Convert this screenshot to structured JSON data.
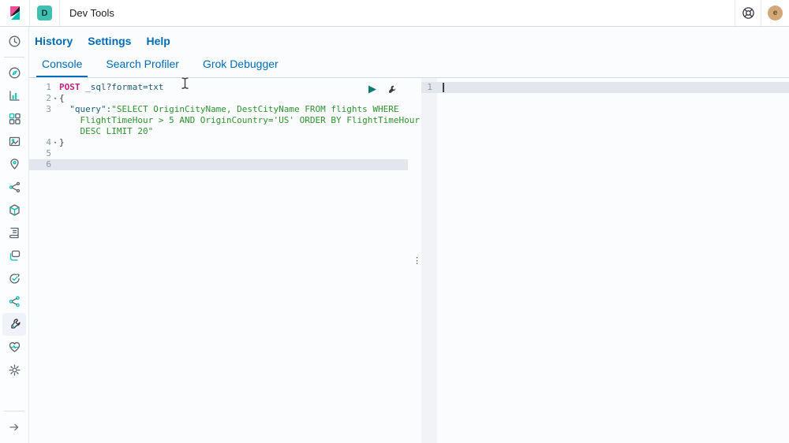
{
  "chrome": {
    "space_badge": "D",
    "title": "Dev Tools",
    "avatar_letter": "e",
    "icons": [
      "kibana-logo",
      "help-icon",
      "user-avatar"
    ]
  },
  "menu": {
    "items": [
      "History",
      "Settings",
      "Help"
    ]
  },
  "tabs": {
    "items": [
      "Console",
      "Search Profiler",
      "Grok Debugger"
    ],
    "active": "Console"
  },
  "sidebar": {
    "items": [
      "recently-viewed",
      "discover",
      "visualize",
      "dashboard",
      "canvas",
      "maps",
      "machine-learning",
      "graph",
      "logs",
      "metrics",
      "uptime",
      "apm",
      "dev-tools",
      "monitoring",
      "management",
      "collapse-nav"
    ],
    "active": "dev-tools"
  },
  "editor": {
    "gutter": [
      "1",
      "2",
      "3",
      "4",
      "5",
      "6"
    ],
    "fold_marker": "▾",
    "request": {
      "method": "POST",
      "url": " _sql?format=txt",
      "open_brace": "{",
      "key": "  \"query\":",
      "string_line1": "\"SELECT OriginCityName, DestCityName FROM flights WHERE",
      "string_line2": "    FlightTimeHour > 5 AND OriginCountry='US' ORDER BY FlightTimeHour",
      "string_line3": "    DESC LIMIT 20\"",
      "close_brace": "}"
    },
    "actions": [
      "send-request",
      "request-options"
    ]
  },
  "output": {
    "gutter": [
      "1"
    ]
  },
  "ui": {
    "resizer_glyph": "⋮"
  },
  "colors": {
    "accent_blue": "#006BB4",
    "teal": "#00BFB3",
    "badge_teal": "#41BFB0",
    "method_magenta": "#C5227A",
    "url_blue": "#1E5B74",
    "string_green": "#2F9030",
    "active_line": "#E3E7ED",
    "border": "#D3DAE6",
    "avatar_tan": "#D2A878"
  }
}
